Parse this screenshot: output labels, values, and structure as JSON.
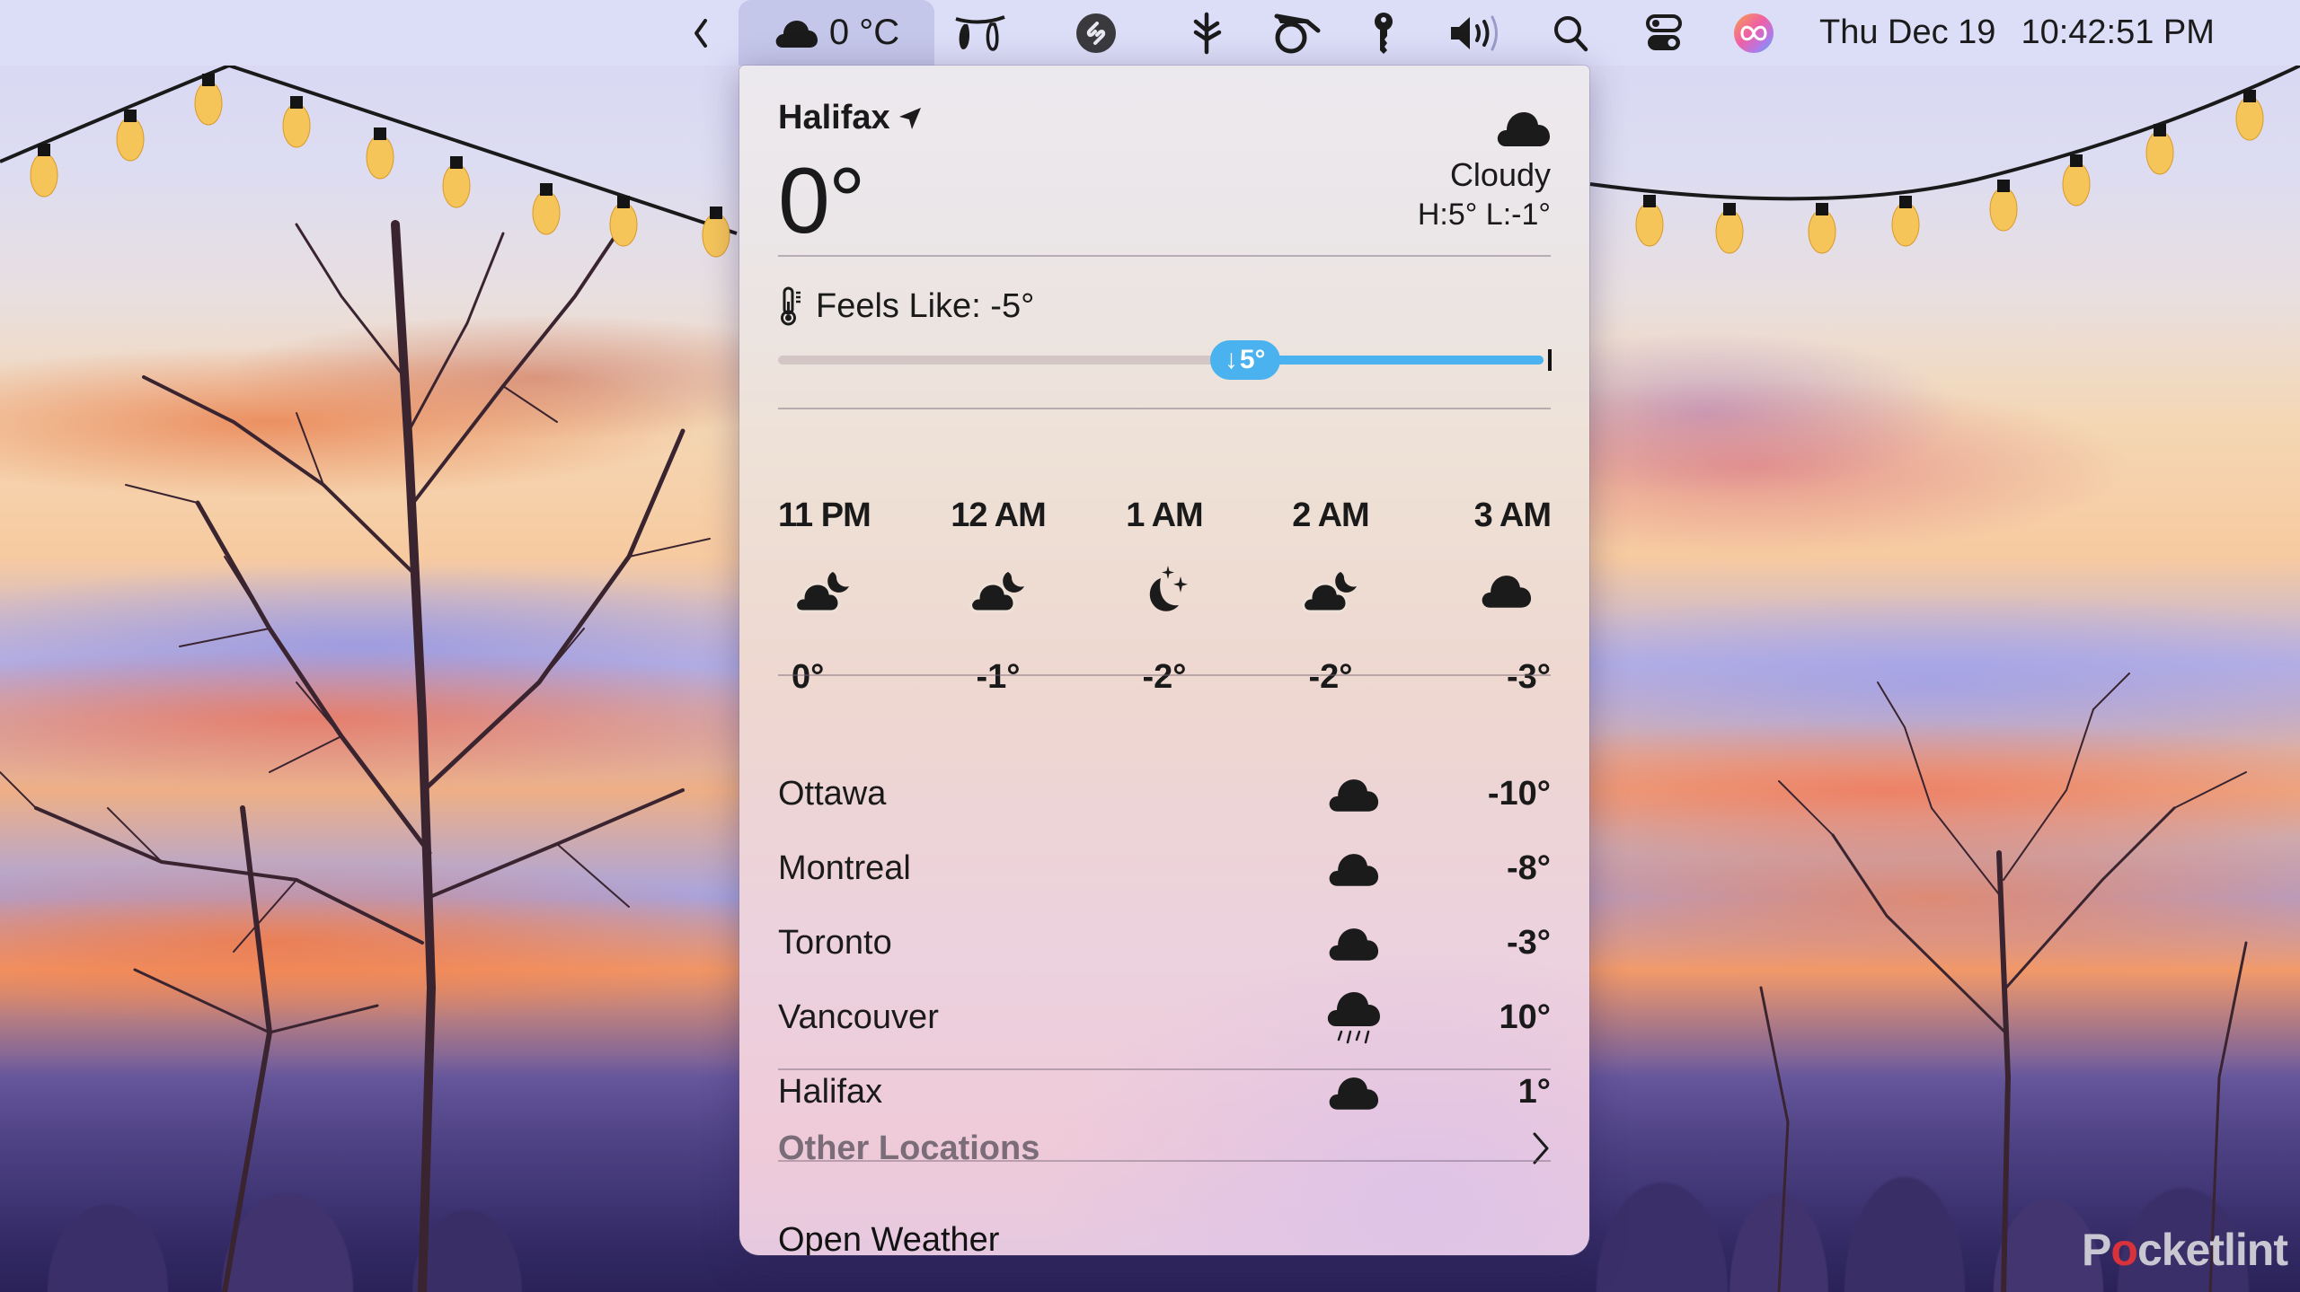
{
  "menubar": {
    "icons": [
      {
        "name": "chevron-left-icon"
      },
      {
        "name": "string-lights-icon"
      },
      {
        "name": "shazam-icon"
      },
      {
        "name": "bluetooth-style-icon"
      },
      {
        "name": "coffee-pot-icon"
      },
      {
        "name": "key-icon"
      },
      {
        "name": "volume-icon"
      },
      {
        "name": "search-icon"
      },
      {
        "name": "control-center-icon"
      },
      {
        "name": "siri-icon"
      }
    ],
    "weather_item": {
      "icon": "cloud-icon",
      "temperature": "0 °C"
    },
    "clock": {
      "date": "Thu Dec 19",
      "time": "10:42:51 PM"
    }
  },
  "weather": {
    "current": {
      "location": "Halifax",
      "location_icon": "location-arrow-icon",
      "temperature": "0°",
      "condition": "Cloudy",
      "condition_icon": "cloud-icon",
      "high_low": "H:5° L:-1°"
    },
    "feels_like": {
      "icon": "thermometer-icon",
      "label": "Feels Like: -5°",
      "delta_label": "5°",
      "delta_direction": "down",
      "fraction": 0.61
    },
    "hourly": [
      {
        "time": "11 PM",
        "icon": "cloud-moon-icon",
        "temp": "0°"
      },
      {
        "time": "12 AM",
        "icon": "cloud-moon-icon",
        "temp": "-1°"
      },
      {
        "time": "1 AM",
        "icon": "moon-stars-icon",
        "temp": "-2°"
      },
      {
        "time": "2 AM",
        "icon": "cloud-moon-icon",
        "temp": "-2°"
      },
      {
        "time": "3 AM",
        "icon": "cloud-icon",
        "temp": "-3°"
      }
    ],
    "cities": [
      {
        "name": "Ottawa",
        "icon": "cloud-icon",
        "temp": "-10°"
      },
      {
        "name": "Montreal",
        "icon": "cloud-icon",
        "temp": "-8°"
      },
      {
        "name": "Toronto",
        "icon": "cloud-icon",
        "temp": "-3°"
      },
      {
        "name": "Vancouver",
        "icon": "cloud-rain-icon",
        "temp": "10°"
      },
      {
        "name": "Halifax",
        "icon": "cloud-icon",
        "temp": "1°"
      }
    ],
    "other_locations_label": "Other Locations",
    "open_weather_label": "Open Weather"
  },
  "watermark": {
    "prefix": "P",
    "accent": "o",
    "suffix": "cketlint"
  },
  "colors": {
    "slider_accent": "#4ab2ee",
    "menubar_bg": "#dcddf7"
  }
}
